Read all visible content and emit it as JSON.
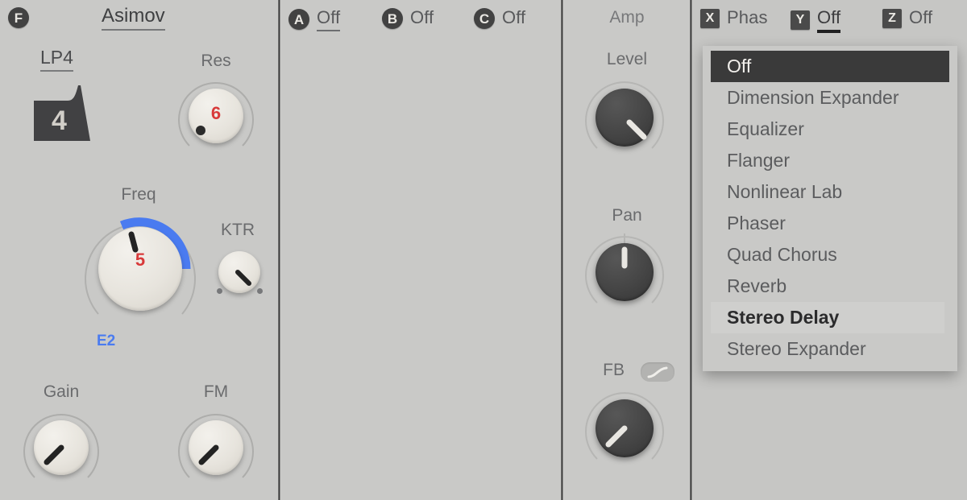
{
  "filter_panel": {
    "badge": "F",
    "preset_name": "Asimov",
    "filter_type": "LP4",
    "shape_number": "4",
    "res": {
      "label": "Res",
      "value": "6"
    },
    "freq": {
      "label": "Freq",
      "value": "5",
      "note": "E2"
    },
    "ktr": {
      "label": "KTR"
    },
    "gain": {
      "label": "Gain"
    },
    "fm": {
      "label": "FM"
    }
  },
  "mod_panel": {
    "slots": [
      {
        "badge": "A",
        "label": "Off",
        "active": true
      },
      {
        "badge": "B",
        "label": "Off",
        "active": false
      },
      {
        "badge": "C",
        "label": "Off",
        "active": false
      }
    ]
  },
  "amp_panel": {
    "title": "Amp",
    "level": {
      "label": "Level"
    },
    "pan": {
      "label": "Pan"
    },
    "fb": {
      "label": "FB",
      "toggle_icon": "curve-icon"
    }
  },
  "fx_panel": {
    "slots": [
      {
        "badge": "X",
        "label": "Phas",
        "active": false
      },
      {
        "badge": "Y",
        "label": "Off",
        "active": true
      },
      {
        "badge": "Z",
        "label": "Off",
        "active": false
      }
    ],
    "dropdown": {
      "selected": "Off",
      "hovered": "Stereo Delay",
      "items": [
        "Off",
        "Dimension Expander",
        "Equalizer",
        "Flanger",
        "Nonlinear Lab",
        "Phaser",
        "Quad Chorus",
        "Reverb",
        "Stereo Delay",
        "Stereo Expander"
      ]
    }
  },
  "colors": {
    "background": "#c9c9c7",
    "value_red": "#d83a3a",
    "note_blue": "#4a7bf0",
    "arc_blue": "#4a7bf0",
    "knob_dark": "#454545",
    "text": "#5b5c5e"
  }
}
